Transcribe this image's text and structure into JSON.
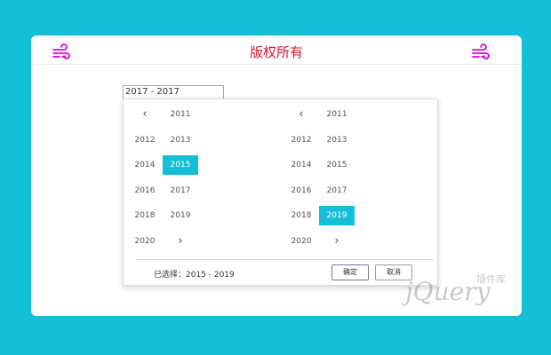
{
  "header": {
    "title": "版权所有",
    "left_icon": "wind-icon",
    "right_icon": "wind-icon",
    "title_color": "#e0142c",
    "icon_color": "#e400d6"
  },
  "range_input": {
    "value": "2017 - 2017"
  },
  "picker": {
    "left_panel": {
      "prev_icon": "chevron-left-icon",
      "prev_label": "‹",
      "years": [
        "2011",
        "2012",
        "2013",
        "2014",
        "2015",
        "2016",
        "2017",
        "2018",
        "2019",
        "2020"
      ],
      "next_icon": "chevron-right-icon",
      "next_label": "›",
      "selected": "2015"
    },
    "right_panel": {
      "prev_icon": "chevron-left-icon",
      "prev_label": "‹",
      "years": [
        "2011",
        "2012",
        "2013",
        "2014",
        "2015",
        "2016",
        "2017",
        "2018",
        "2019",
        "2020"
      ],
      "next_icon": "chevron-right-icon",
      "next_label": "›",
      "selected": "2019"
    },
    "selection_text": "已选择：2015 - 2019",
    "confirm_label": "确定",
    "cancel_label": "取消",
    "accent_color": "#15bfd7"
  },
  "watermark": {
    "text": "jQuery",
    "subtext": "插件库"
  }
}
